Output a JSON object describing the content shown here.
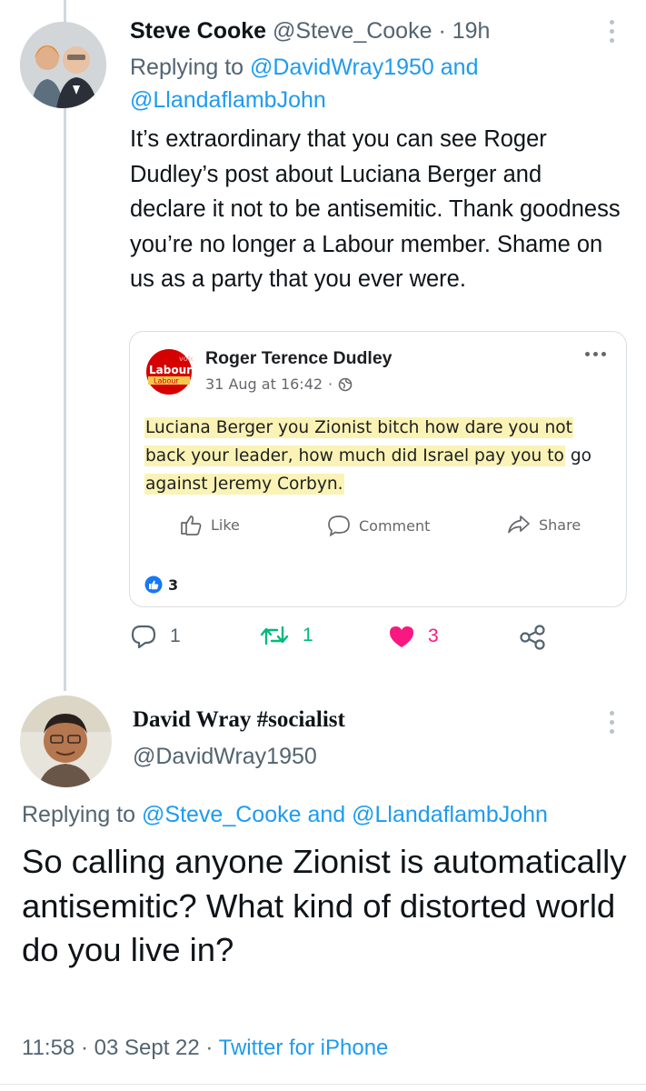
{
  "tweet1": {
    "name": "Steve Cooke",
    "handle": "@Steve_Cooke",
    "sep": "·",
    "time": "19h",
    "replying_prefix": "Replying to",
    "replying_user1": "@DavidWray1950",
    "replying_and": "and",
    "replying_user2": "@LlandaflambJohn",
    "body": "It’s extraordinary that you can see Roger Dudley’s post about Luciana Berger and declare it not to be antisemitic. Thank goodness you’re no longer a Labour member. Shame on us as a party that you ever were.",
    "embed": {
      "logo_small": "vote",
      "logo_main": "Labour",
      "logo_sub": "Labour",
      "author": "Roger Terence Dudley",
      "date": "31 Aug at 16:42",
      "date_sep": "·",
      "text_line1": "Luciana Berger you Zionist bitch how dare you not",
      "text_line2": "back your leader, how much did Israel pay you to",
      "text_line2_tail": "go",
      "text_line3": "against Jeremy Corbyn.",
      "like_label": "Like",
      "comment_label": "Comment",
      "share_label": "Share",
      "reaction_count": "3"
    },
    "actions": {
      "replies": "1",
      "retweets": "1",
      "likes": "3"
    },
    "colors": {
      "retweet": "#00ba7c",
      "like": "#f91880",
      "fb_blue": "#1877f2",
      "labour_red": "#d50000"
    }
  },
  "tweet2": {
    "name": "David Wray #socialist",
    "handle": "@DavidWray1950",
    "replying_prefix": "Replying to",
    "replying_user1": "@Steve_Cooke",
    "replying_and": "and",
    "replying_user2": "@LlandaflambJohn",
    "body": "So calling anyone Zionist is automatically antisemitic? What kind of distorted world do you live in?",
    "time": "11:58",
    "sep1": "·",
    "date": "03 Sept 22",
    "sep2": "·",
    "client": "Twitter for iPhone"
  },
  "icons": [
    "reply-icon",
    "retweet-icon",
    "heart-icon",
    "share-icon",
    "like-thumb-icon",
    "comment-icon",
    "fb-share-icon",
    "globe-icon",
    "more-icon"
  ]
}
